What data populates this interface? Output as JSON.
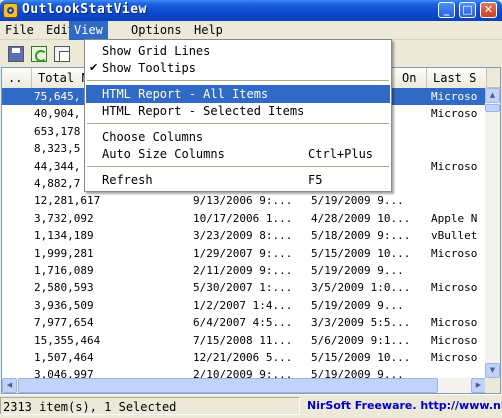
{
  "window": {
    "title": "OutlookStatView"
  },
  "titlebar_buttons": [
    {
      "name": "minimize-button",
      "label": "_"
    },
    {
      "name": "maximize-button",
      "label": "□"
    },
    {
      "name": "close-button",
      "label": "✕"
    }
  ],
  "menubar": {
    "items": [
      {
        "label": "File"
      },
      {
        "label": "Edit"
      },
      {
        "label": "View"
      },
      {
        "label": "Options"
      },
      {
        "label": "Help"
      }
    ]
  },
  "toolbar": {
    "icons": [
      "save-icon",
      "refresh-icon",
      "copy-icon"
    ]
  },
  "list": {
    "columns": [
      {
        "label": ".."
      },
      {
        "label": "Total N"
      },
      {
        "label": ""
      },
      {
        "label": "On"
      },
      {
        "label": "Last S"
      }
    ],
    "rows": [
      {
        "c0": "",
        "c1": "75,645,",
        "c2": "",
        "c3": "",
        "c4": "Microso",
        "selected": true
      },
      {
        "c0": "",
        "c1": "40,904,",
        "c2": "",
        "c3": "",
        "c4": "Microso"
      },
      {
        "c0": "",
        "c1": "653,178",
        "c2": "",
        "c3": "",
        "c4": ""
      },
      {
        "c0": "",
        "c1": "8,323,5",
        "c2": "",
        "c3": "",
        "c4": ""
      },
      {
        "c0": "",
        "c1": "44,344,",
        "c2": "",
        "c3": "",
        "c4": "Microso"
      },
      {
        "c0": "",
        "c1": "4,882,7",
        "c2": "",
        "c3": "",
        "c4": ""
      },
      {
        "c0": "",
        "c1": "12,281,617",
        "c2": "9/13/2006 9:...",
        "c3": "5/19/2009 9...",
        "c4": ""
      },
      {
        "c0": "",
        "c1": "3,732,092",
        "c2": "10/17/2006 1...",
        "c3": "4/28/2009 10...",
        "c4": "Apple N"
      },
      {
        "c0": "",
        "c1": "1,134,189",
        "c2": "3/23/2009 8:...",
        "c3": "5/18/2009 9:...",
        "c4": "vBullet"
      },
      {
        "c0": "",
        "c1": "1,999,281",
        "c2": "1/29/2007 9:...",
        "c3": "5/15/2009 10...",
        "c4": "Microso"
      },
      {
        "c0": "",
        "c1": "1,716,089",
        "c2": "2/11/2009 9:...",
        "c3": "5/19/2009 9...",
        "c4": ""
      },
      {
        "c0": "",
        "c1": "2,580,593",
        "c2": "5/30/2007 1:...",
        "c3": "3/5/2009 1:0...",
        "c4": "Microso"
      },
      {
        "c0": "",
        "c1": "3,936,509",
        "c2": "1/2/2007 1:4...",
        "c3": "5/19/2009 9...",
        "c4": ""
      },
      {
        "c0": "",
        "c1": "7,977,654",
        "c2": "6/4/2007 4:5...",
        "c3": "3/3/2009 5:5...",
        "c4": "Microso"
      },
      {
        "c0": "",
        "c1": "15,355,464",
        "c2": "7/15/2008 11...",
        "c3": "5/6/2009 9:1...",
        "c4": "Microso"
      },
      {
        "c0": "",
        "c1": "1,507,464",
        "c2": "12/21/2006 5...",
        "c3": "5/15/2009 10...",
        "c4": "Microso"
      },
      {
        "c0": "",
        "c1": "3,046,997",
        "c2": "2/10/2009 9:...",
        "c3": "5/19/2009 9...",
        "c4": ""
      }
    ]
  },
  "status": {
    "items_text": "2313 item(s), 1 Selected",
    "brand": "NirSoft Freeware.",
    "url": "http://www.nirs"
  },
  "view_menu": {
    "items": [
      {
        "label": "Show Grid Lines",
        "checked": false,
        "shortcut": ""
      },
      {
        "label": "Show Tooltips",
        "checked": true,
        "check_mark": "✔",
        "shortcut": ""
      },
      {
        "label": "HTML Report - All Items",
        "shortcut": "",
        "highlighted": true
      },
      {
        "label": "HTML Report - Selected Items",
        "shortcut": ""
      },
      {
        "label": "Choose Columns",
        "shortcut": ""
      },
      {
        "label": "Auto Size Columns",
        "shortcut": "Ctrl+Plus"
      },
      {
        "label": "Refresh",
        "shortcut": "F5"
      }
    ]
  },
  "colors": {
    "titlebar": "#0a4ad0",
    "selection": "#316ac5",
    "window_bg": "#ece9d8",
    "link": "#0000cc"
  }
}
